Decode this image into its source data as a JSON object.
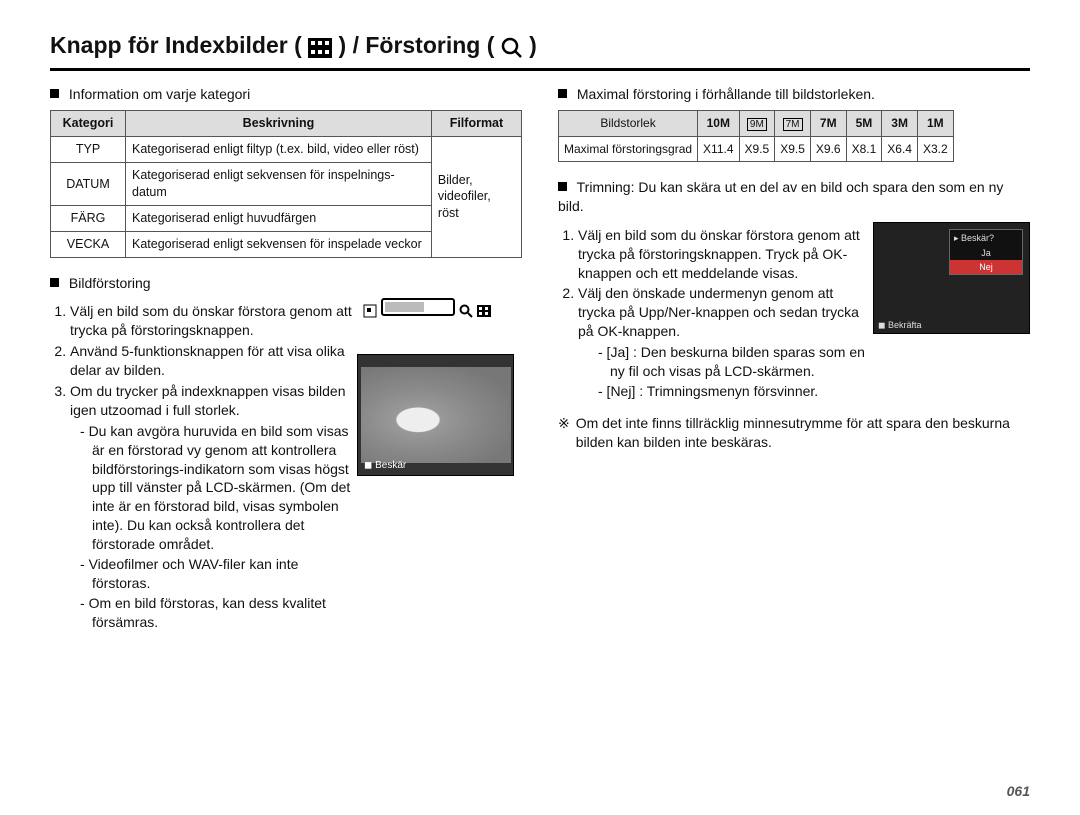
{
  "title_prefix": "Knapp för Indexbilder (",
  "title_mid": ") / Förstoring (",
  "title_suffix": ")",
  "left": {
    "cat_intro": "Information om varje kategori",
    "cat_headers": [
      "Kategori",
      "Beskrivning",
      "Filformat"
    ],
    "cat_rows": [
      {
        "k": "TYP",
        "d": "Kategoriserad enligt filtyp (t.ex. bild, video eller röst)"
      },
      {
        "k": "DATUM",
        "d": "Kategoriserad enligt sekvensen för inspelnings­datum"
      },
      {
        "k": "FÄRG",
        "d": "Kategoriserad enligt huvudfärgen"
      },
      {
        "k": "VECKA",
        "d": "Kategoriserad enligt sekvensen för inspelade veckor"
      }
    ],
    "cat_format": "Bilder,\nvideofiler, röst",
    "enlarge_head": "Bildförstoring",
    "steps": [
      "Välj en bild som du önskar förstora genom att trycka på förstoringsknappen.",
      "Använd 5-funktionsknappen för att visa olika delar av bilden.",
      "Om du trycker på indexknappen visas bilden igen utzoomad i full storlek."
    ],
    "dashes": [
      "Du kan avgöra huruvida en bild som visas är en förstorad vy genom att kontrollera bildförstorings-indikatorn som visas högst upp till vänster på LCD-skärmen. (Om det inte är en förstorad bild, visas symbolen inte). Du kan också kontrollera det förstorade området.",
      "Videofilmer och WAV-filer kan inte förstoras.",
      "Om en bild förstoras, kan dess kvalitet försämras."
    ],
    "lcd_caption": "Beskär"
  },
  "right": {
    "max_head": "Maximal förstoring i förhållande till bildstorleken.",
    "size_label": "Bildstorlek",
    "size_icons": [
      "10M",
      "9M",
      "7M",
      "7M",
      "5M",
      "3M",
      "1M"
    ],
    "ratio_label": "Maximal förstoringsgrad",
    "ratios": [
      "X11.4",
      "X9.5",
      "X9.5",
      "X9.6",
      "X8.1",
      "X6.4",
      "X3.2"
    ],
    "trim_head": "Trimning: Du kan skära ut en del av en bild och spara den som en ny bild.",
    "trim_steps": [
      "Välj en bild som du önskar förstora genom att trycka på förstoring­sknappen. Tryck på OK-knappen och ett meddelande visas.",
      "Välj den önskade undermenyn genom att trycka på Upp/Ner-knappen och sedan trycka på OK-knappen."
    ],
    "trim_opts": [
      "- [Ja]  : Den beskurna bilden sparas som en ny fil och visas på LCD-skärmen.",
      "- [Nej] : Trimningsmenyn försvinner."
    ],
    "note_mark": "※",
    "note": "Om det inte finns tillräcklig minnesutrymme för att spara den beskurna bilden kan bilden inte beskäras.",
    "panel": {
      "head": "Beskär?",
      "yes": "Ja",
      "no": "Nej",
      "confirm": "Bekräfta"
    }
  },
  "page_number": "061"
}
